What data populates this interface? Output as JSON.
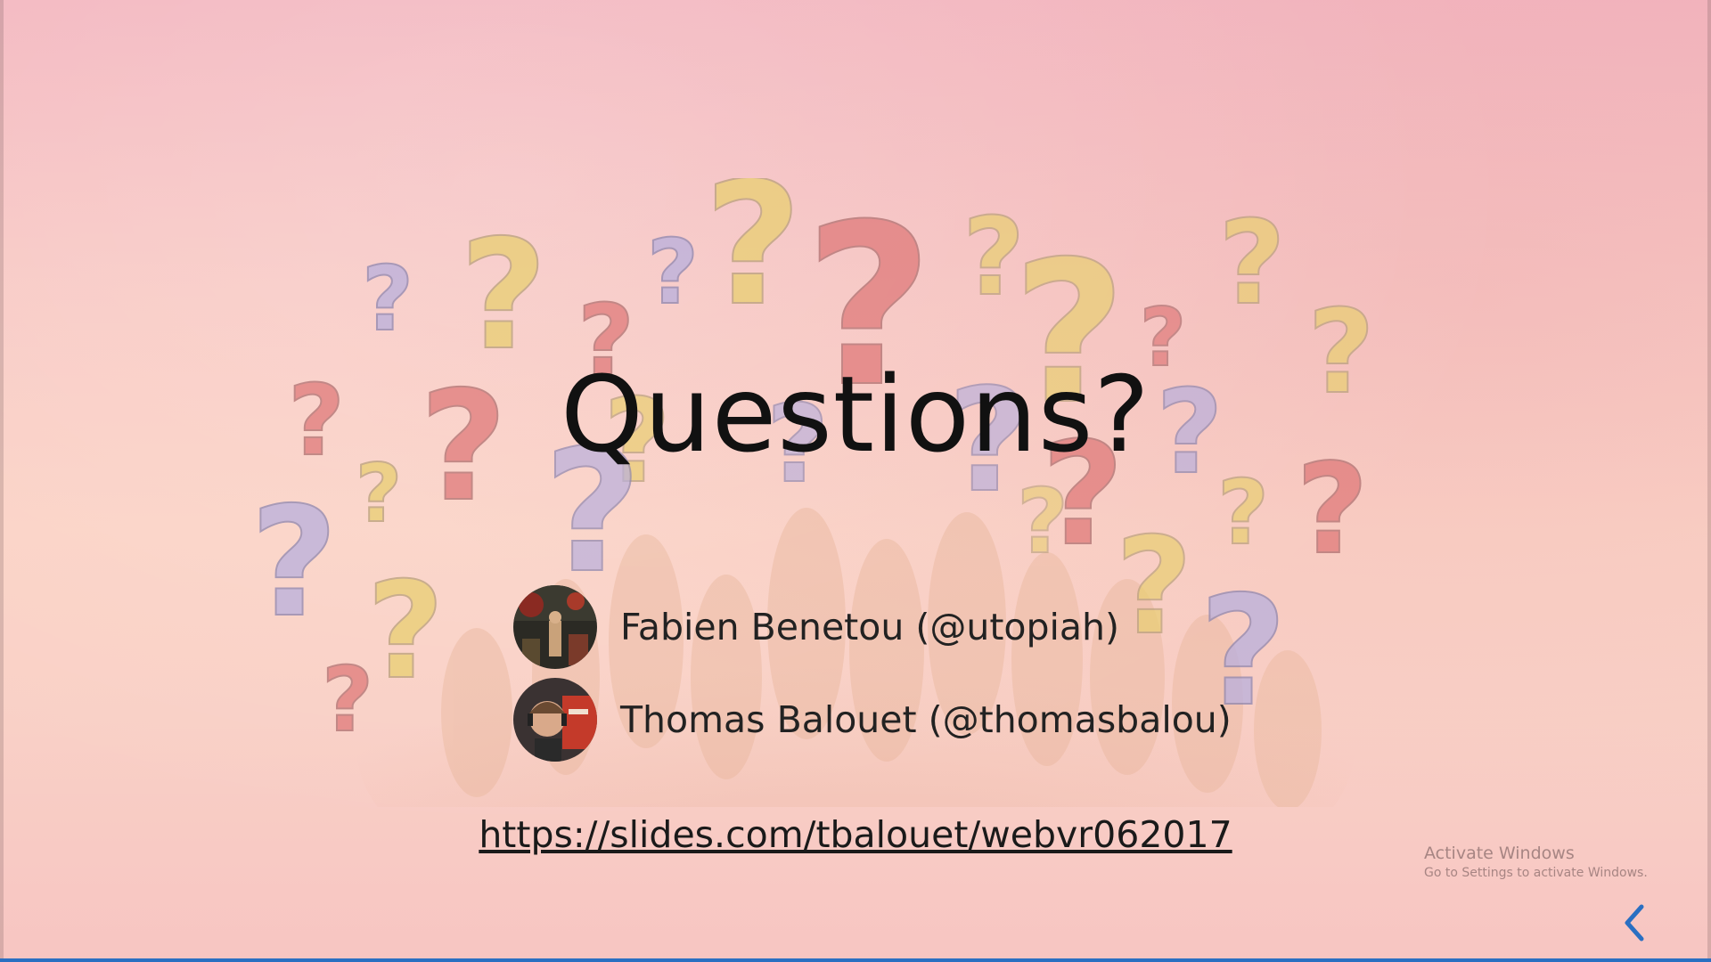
{
  "slide": {
    "title": "Questions?",
    "speakers": [
      {
        "name": "Fabien Benetou (@utopiah)"
      },
      {
        "name": "Thomas Balouet (@thomasbalou)"
      }
    ],
    "link": "https://slides.com/tbalouet/webvr062017"
  },
  "watermark": {
    "title": "Activate Windows",
    "subtitle": "Go to Settings to activate Windows."
  },
  "navigation": {
    "prev_icon": "chevron-left-icon"
  },
  "colors": {
    "accent": "#2a6fc2",
    "question_red": "#e07a7a",
    "question_yellow": "#e9cf72",
    "question_purple": "#b9b0dd"
  }
}
